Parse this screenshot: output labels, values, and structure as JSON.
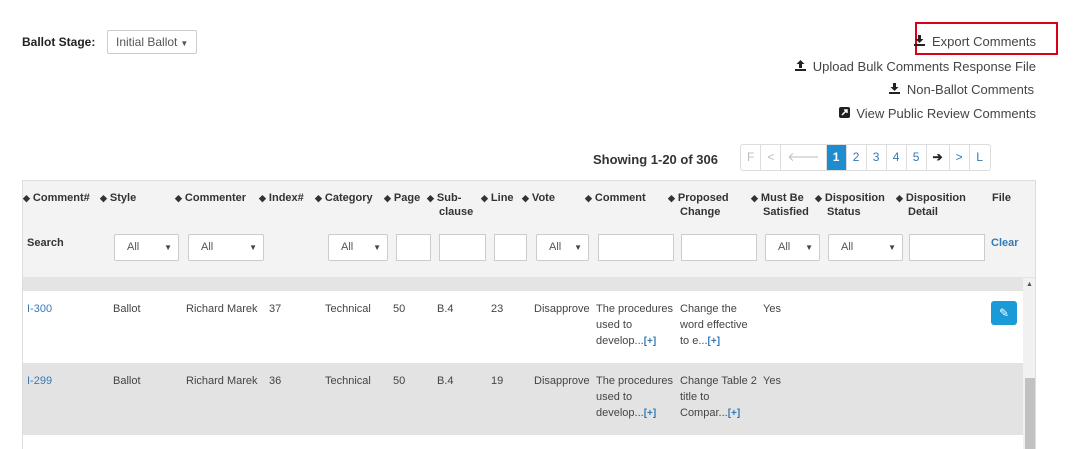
{
  "ballot_stage": {
    "label": "Ballot Stage:",
    "value": "Initial Ballot"
  },
  "actions": {
    "export_comments": "Export Comments",
    "upload_bulk": "Upload Bulk Comments Response File",
    "non_ballot": "Non-Ballot Comments",
    "view_public": "View Public Review Comments"
  },
  "pagination": {
    "showing": "Showing 1-20 of 306",
    "first": "F",
    "prev": "<",
    "prev_group": "🡐",
    "pages": [
      "1",
      "2",
      "3",
      "4",
      "5"
    ],
    "next_group": "➔",
    "next": ">",
    "last": "L",
    "current_page": "1"
  },
  "table": {
    "headers": {
      "comment_no": "Comment#",
      "style": "Style",
      "commenter": "Commenter",
      "index": "Index#",
      "category": "Category",
      "page": "Page",
      "subclause_1": "Sub-",
      "subclause_2": "clause",
      "line": "Line",
      "vote": "Vote",
      "comment": "Comment",
      "proposed_1": "Proposed",
      "proposed_2": "Change",
      "must_be_1": "Must Be",
      "must_be_2": "Satisfied",
      "disp_status_1": "Disposition",
      "disp_status_2": "Status",
      "disp_detail_1": "Disposition",
      "disp_detail_2": "Detail",
      "file": "File"
    },
    "filters": {
      "search_label": "Search",
      "style": "All",
      "commenter": "All",
      "category": "All",
      "vote": "All",
      "must_be": "All",
      "disp_status": "All",
      "clear": "Clear"
    },
    "rows": [
      {
        "comment_no": "I-300",
        "style": "Ballot",
        "commenter": "Richard Marek",
        "index": "37",
        "category": "Technical",
        "page": "50",
        "subclause": "B.4",
        "line": "23",
        "vote": "Disapprove",
        "comment_l1": "The procedures",
        "comment_l2": "used to",
        "comment_l3": "develop...",
        "proposed_l1": "Change the",
        "proposed_l2": "word effective",
        "proposed_l3": "to e...",
        "more": "[+]",
        "must_be": "Yes"
      },
      {
        "comment_no": "I-299",
        "style": "Ballot",
        "commenter": "Richard Marek",
        "index": "36",
        "category": "Technical",
        "page": "50",
        "subclause": "B.4",
        "line": "19",
        "vote": "Disapprove",
        "comment_l1": "The procedures",
        "comment_l2": "used to",
        "comment_l3": "develop...",
        "proposed_l1": "Change Table 2",
        "proposed_l2": "title to",
        "proposed_l3": "Compar...",
        "more": "[+]",
        "must_be": "Yes"
      }
    ]
  },
  "icons": {
    "download": "download-icon",
    "upload": "upload-icon",
    "external": "external-link-icon",
    "edit": "pencil-icon"
  },
  "colors": {
    "highlight_border": "#d9001b",
    "link": "#337ab7",
    "active_page": "#1f8ccf",
    "edit_button": "#1a9bd7"
  }
}
